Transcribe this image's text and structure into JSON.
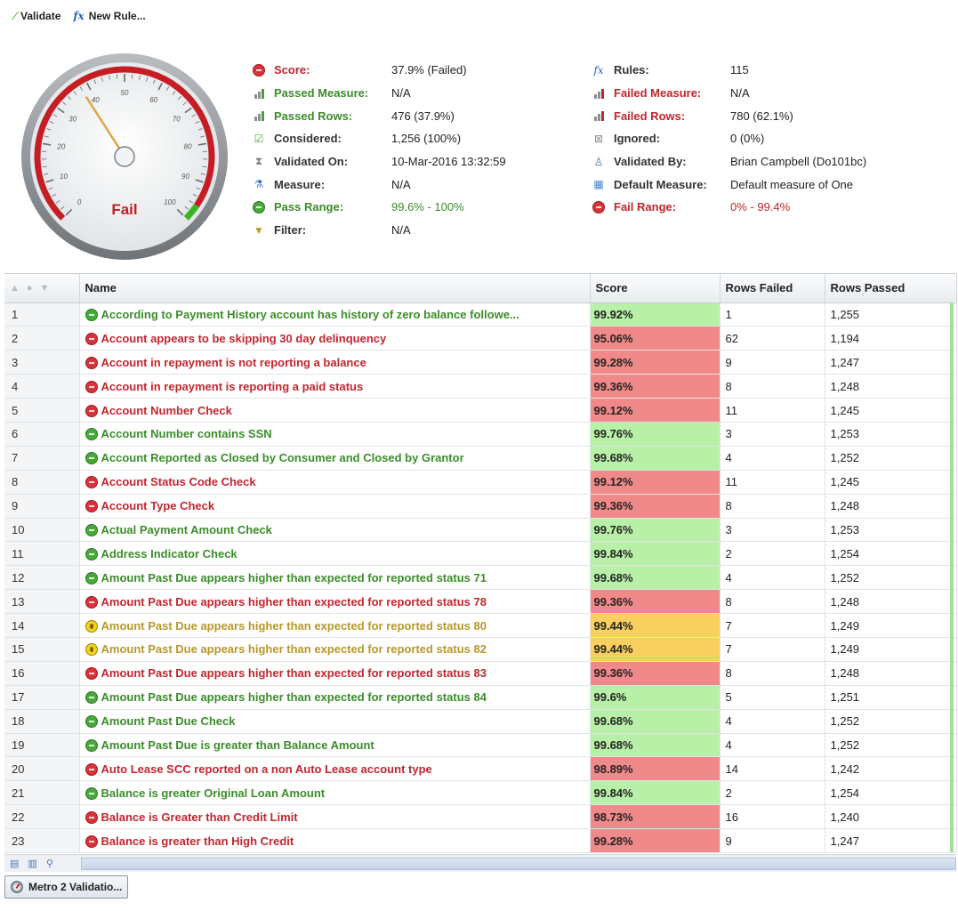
{
  "toolbar": {
    "validate_label": "Validate",
    "new_rule_label": "New Rule..."
  },
  "gauge": {
    "label": "Fail",
    "ticks": [
      "0",
      "10",
      "20",
      "30",
      "40",
      "50",
      "60",
      "70",
      "80",
      "90",
      "100"
    ],
    "value_percent": 37.9,
    "accent": "#c41e24"
  },
  "summary_left": [
    {
      "icon": "status-red",
      "label": "Score:",
      "value": "37.9% (Failed)",
      "label_color": "red",
      "value_color": "dark"
    },
    {
      "icon": "bars-green",
      "label": "Passed Measure:",
      "value": "N/A",
      "label_color": "green",
      "value_color": "dark"
    },
    {
      "icon": "bars-green",
      "label": "Passed Rows:",
      "value": "476 (37.9%)",
      "label_color": "green",
      "value_color": "dark"
    },
    {
      "icon": "checkmark-grid",
      "label": "Considered:",
      "value": "1,256 (100%)",
      "label_color": "dark",
      "value_color": "dark"
    },
    {
      "icon": "clock-stack",
      "label": "Validated On:",
      "value": "10-Mar-2016 13:32:59",
      "label_color": "dark",
      "value_color": "dark"
    },
    {
      "icon": "flask",
      "label": "Measure:",
      "value": "N/A",
      "label_color": "dark",
      "value_color": "dark"
    },
    {
      "icon": "status-green",
      "label": "Pass Range:",
      "value": "99.6% - 100%",
      "label_color": "green",
      "value_color": "green"
    },
    {
      "icon": "filter",
      "label": "Filter:",
      "value": "N/A",
      "label_color": "dark",
      "value_color": "dark"
    }
  ],
  "summary_right": [
    {
      "icon": "fx",
      "label": "Rules:",
      "value": "115",
      "label_color": "dark",
      "value_color": "dark"
    },
    {
      "icon": "bars-red",
      "label": "Failed Measure:",
      "value": "N/A",
      "label_color": "red",
      "value_color": "dark"
    },
    {
      "icon": "bars-red",
      "label": "Failed Rows:",
      "value": "780 (62.1%)",
      "label_color": "red",
      "value_color": "dark"
    },
    {
      "icon": "ignored",
      "label": "Ignored:",
      "value": "0 (0%)",
      "label_color": "dark",
      "value_color": "dark"
    },
    {
      "icon": "user",
      "label": "Validated By:",
      "value": "Brian Campbell (Do101bc)",
      "label_color": "dark",
      "value_color": "dark"
    },
    {
      "icon": "measure-blocks",
      "label": "Default Measure:",
      "value": "Default measure of One",
      "label_color": "dark",
      "value_color": "dark"
    },
    {
      "icon": "status-red",
      "label": "Fail Range:",
      "value": "0% - 99.4%",
      "label_color": "red",
      "value_color": "red"
    }
  ],
  "table": {
    "columns": [
      "Name",
      "Score",
      "Rows Failed",
      "Rows Passed"
    ],
    "rows": [
      {
        "n": "1",
        "status": "pass",
        "name": "According to Payment History account has history of zero balance followe...",
        "score": "99.92%",
        "failed": "1",
        "passed": "1,255"
      },
      {
        "n": "2",
        "status": "fail",
        "name": "Account appears to be skipping 30 day delinquency",
        "score": "95.06%",
        "failed": "62",
        "passed": "1,194"
      },
      {
        "n": "3",
        "status": "fail",
        "name": "Account in repayment is not reporting a balance",
        "score": "99.28%",
        "failed": "9",
        "passed": "1,247"
      },
      {
        "n": "4",
        "status": "fail",
        "name": "Account in repayment is reporting a paid status",
        "score": "99.36%",
        "failed": "8",
        "passed": "1,248"
      },
      {
        "n": "5",
        "status": "fail",
        "name": "Account Number Check",
        "score": "99.12%",
        "failed": "11",
        "passed": "1,245"
      },
      {
        "n": "6",
        "status": "pass",
        "name": "Account Number contains SSN",
        "score": "99.76%",
        "failed": "3",
        "passed": "1,253"
      },
      {
        "n": "7",
        "status": "pass",
        "name": "Account Reported as Closed by Consumer and Closed by Grantor",
        "score": "99.68%",
        "failed": "4",
        "passed": "1,252"
      },
      {
        "n": "8",
        "status": "fail",
        "name": "Account Status Code Check",
        "score": "99.12%",
        "failed": "11",
        "passed": "1,245"
      },
      {
        "n": "9",
        "status": "fail",
        "name": "Account Type Check",
        "score": "99.36%",
        "failed": "8",
        "passed": "1,248"
      },
      {
        "n": "10",
        "status": "pass",
        "name": "Actual Payment Amount Check",
        "score": "99.76%",
        "failed": "3",
        "passed": "1,253"
      },
      {
        "n": "11",
        "status": "pass",
        "name": "Address Indicator Check",
        "score": "99.84%",
        "failed": "2",
        "passed": "1,254"
      },
      {
        "n": "12",
        "status": "pass",
        "name": "Amount Past Due appears higher than expected for reported status 71",
        "score": "99.68%",
        "failed": "4",
        "passed": "1,252"
      },
      {
        "n": "13",
        "status": "fail",
        "name": "Amount Past Due appears higher than expected for reported status 78",
        "score": "99.36%",
        "failed": "8",
        "passed": "1,248"
      },
      {
        "n": "14",
        "status": "warn",
        "name": "Amount Past Due appears higher than expected for reported status 80",
        "score": "99.44%",
        "failed": "7",
        "passed": "1,249"
      },
      {
        "n": "15",
        "status": "warn",
        "name": "Amount Past Due appears higher than expected for reported status 82",
        "score": "99.44%",
        "failed": "7",
        "passed": "1,249"
      },
      {
        "n": "16",
        "status": "fail",
        "name": "Amount Past Due appears higher than expected for reported status 83",
        "score": "99.36%",
        "failed": "8",
        "passed": "1,248"
      },
      {
        "n": "17",
        "status": "pass",
        "name": "Amount Past Due appears higher than expected for reported status 84",
        "score": "99.6%",
        "failed": "5",
        "passed": "1,251"
      },
      {
        "n": "18",
        "status": "pass",
        "name": "Amount Past Due Check",
        "score": "99.68%",
        "failed": "4",
        "passed": "1,252"
      },
      {
        "n": "19",
        "status": "pass",
        "name": "Amount Past Due is greater than Balance Amount",
        "score": "99.68%",
        "failed": "4",
        "passed": "1,252"
      },
      {
        "n": "20",
        "status": "fail",
        "name": "Auto Lease SCC reported on a non Auto Lease account type",
        "score": "98.89%",
        "failed": "14",
        "passed": "1,242"
      },
      {
        "n": "21",
        "status": "pass",
        "name": "Balance is greater Original Loan Amount",
        "score": "99.84%",
        "failed": "2",
        "passed": "1,254"
      },
      {
        "n": "22",
        "status": "fail",
        "name": "Balance is Greater than Credit Limit",
        "score": "98.73%",
        "failed": "16",
        "passed": "1,240"
      },
      {
        "n": "23",
        "status": "fail",
        "name": "Balance is greater than High Credit",
        "score": "99.28%",
        "failed": "9",
        "passed": "1,247"
      }
    ]
  },
  "status_tab": {
    "label": "Metro 2 Validatio..."
  }
}
